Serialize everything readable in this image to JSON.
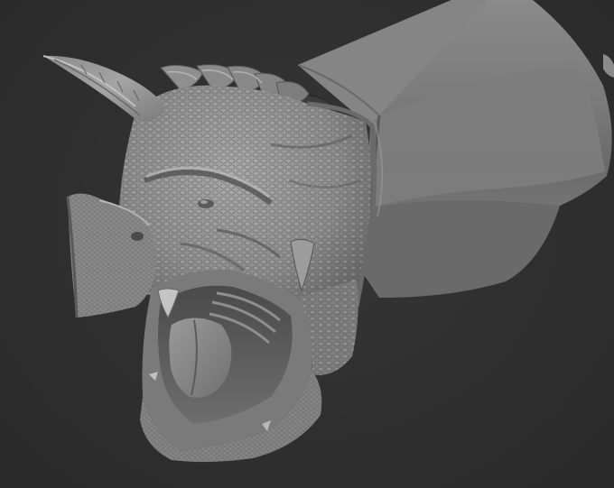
{
  "canvas": {
    "background_color": "#2e2e2e",
    "clay_color": "#8c8c8c",
    "clay_shadow": "#3a3a3a",
    "clay_highlight": "#bdbdbd"
  },
  "subject": {
    "icon": "dragon-head-sculpt"
  }
}
